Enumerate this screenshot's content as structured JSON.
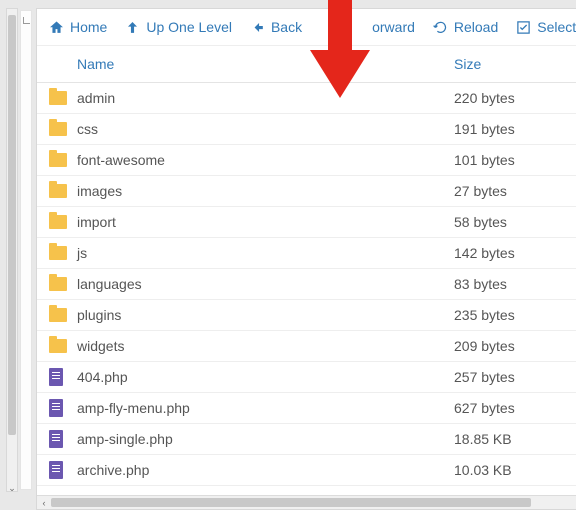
{
  "toolbar": {
    "home": "Home",
    "up": "Up One Level",
    "back": "Back",
    "forward": "orward",
    "reload": "Reload",
    "select": "Select"
  },
  "columns": {
    "name": "Name",
    "size": "Size"
  },
  "rows": [
    {
      "type": "folder",
      "name": "admin",
      "size": "220 bytes"
    },
    {
      "type": "folder",
      "name": "css",
      "size": "191 bytes"
    },
    {
      "type": "folder",
      "name": "font-awesome",
      "size": "101 bytes"
    },
    {
      "type": "folder",
      "name": "images",
      "size": "27 bytes"
    },
    {
      "type": "folder",
      "name": "import",
      "size": "58 bytes"
    },
    {
      "type": "folder",
      "name": "js",
      "size": "142 bytes"
    },
    {
      "type": "folder",
      "name": "languages",
      "size": "83 bytes"
    },
    {
      "type": "folder",
      "name": "plugins",
      "size": "235 bytes"
    },
    {
      "type": "folder",
      "name": "widgets",
      "size": "209 bytes"
    },
    {
      "type": "file",
      "name": "404.php",
      "size": "257 bytes"
    },
    {
      "type": "file",
      "name": "amp-fly-menu.php",
      "size": "627 bytes"
    },
    {
      "type": "file",
      "name": "amp-single.php",
      "size": "18.85 KB"
    },
    {
      "type": "file",
      "name": "archive.php",
      "size": "10.03 KB"
    }
  ]
}
